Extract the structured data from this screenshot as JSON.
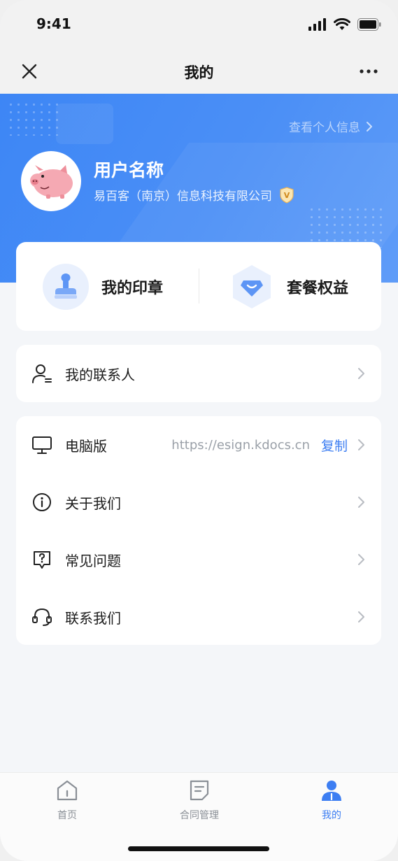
{
  "status_bar": {
    "time": "9:41"
  },
  "nav": {
    "title": "我的"
  },
  "profile": {
    "view_link": "查看个人信息",
    "name": "用户名称",
    "company": "易百客（南京）信息科技有限公司",
    "badge": "V"
  },
  "quick_actions": [
    {
      "label": "我的印章",
      "icon": "stamp-icon"
    },
    {
      "label": "套餐权益",
      "icon": "diamond-icon"
    }
  ],
  "contacts": {
    "label": "我的联系人"
  },
  "menu": [
    {
      "label": "电脑版",
      "icon": "monitor-icon",
      "url": "https://esign.kdocs.cn",
      "copy": "复制"
    },
    {
      "label": "关于我们",
      "icon": "info-icon"
    },
    {
      "label": "常见问题",
      "icon": "help-icon"
    },
    {
      "label": "联系我们",
      "icon": "headset-icon"
    }
  ],
  "tabs": [
    {
      "label": "首页",
      "icon": "home-icon",
      "active": false
    },
    {
      "label": "合同管理",
      "icon": "document-icon",
      "active": false
    },
    {
      "label": "我的",
      "icon": "user-icon",
      "active": true
    }
  ],
  "colors": {
    "accent": "#3d7ef2",
    "hero": "#4b8ff6",
    "background": "#f4f6f9"
  }
}
